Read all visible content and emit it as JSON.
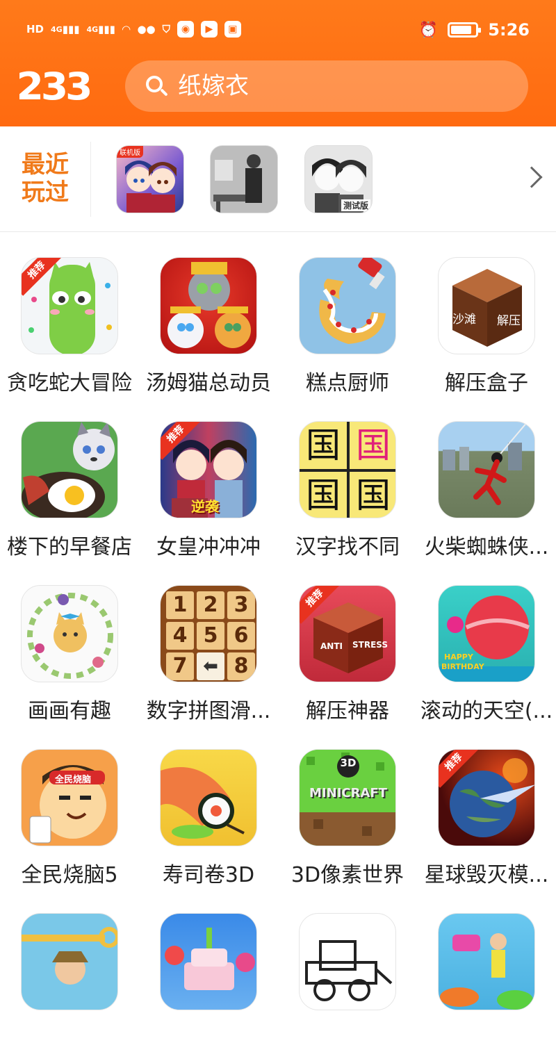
{
  "status_bar": {
    "left_icons": [
      "HD",
      "4G",
      "4G"
    ],
    "time": "5:26",
    "battery_level": 0.85
  },
  "header": {
    "logo_text": "233",
    "search_query": "纸嫁衣"
  },
  "recent": {
    "label_line1": "最近",
    "label_line2": "玩过",
    "thumb1_tag": "联机版",
    "thumb3_tag": "测试版"
  },
  "apps": [
    {
      "name": "贪吃蛇大冒险",
      "badge": "推荐"
    },
    {
      "name": "汤姆猫总动员",
      "badge": ""
    },
    {
      "name": "糕点厨师",
      "badge": ""
    },
    {
      "name": "解压盒子",
      "badge": "",
      "icon_text1": "沙滩",
      "icon_text2": "解压"
    },
    {
      "name": "楼下的早餐店",
      "badge": ""
    },
    {
      "name": "女皇冲冲冲",
      "badge": "推荐",
      "icon_text1": "逆袭"
    },
    {
      "name": "汉字找不同",
      "badge": "",
      "icon_text1": "国"
    },
    {
      "name": "火柴蜘蛛侠...",
      "badge": ""
    },
    {
      "name": "画画有趣",
      "badge": ""
    },
    {
      "name": "数字拼图滑...",
      "badge": ""
    },
    {
      "name": "解压神器",
      "badge": "推荐",
      "icon_text1": "ANTI",
      "icon_text2": "STRESS"
    },
    {
      "name": "滚动的天空(...",
      "badge": "",
      "icon_text1": "HAPPY",
      "icon_text2": "BIRTHDAY"
    },
    {
      "name": "全民烧脑5",
      "badge": "",
      "icon_text1": "全民烧脑"
    },
    {
      "name": "寿司卷3D",
      "badge": ""
    },
    {
      "name": "3D像素世界",
      "badge": "",
      "icon_text1": "3D",
      "icon_text2": "MINICRAFT"
    },
    {
      "name": "星球毁灭模...",
      "badge": "推荐"
    },
    {
      "name": "",
      "badge": ""
    },
    {
      "name": "",
      "badge": ""
    },
    {
      "name": "",
      "badge": ""
    },
    {
      "name": "",
      "badge": ""
    }
  ],
  "number_puzzle": [
    "1",
    "2",
    "3",
    "4",
    "5",
    "6",
    "7",
    "8"
  ]
}
